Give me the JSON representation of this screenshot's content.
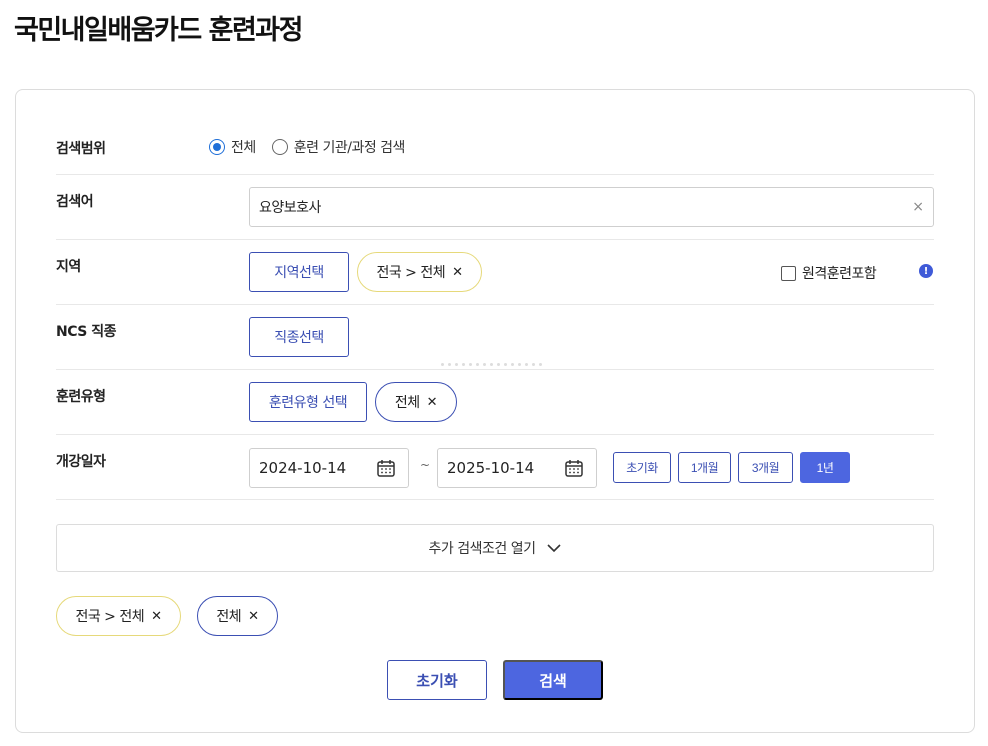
{
  "page": {
    "title": "국민내일배움카드 훈련과정"
  },
  "scope": {
    "label": "검색범위",
    "options": [
      {
        "label": "전체",
        "checked": true
      },
      {
        "label": "훈련 기관/과정 검색",
        "checked": false
      }
    ]
  },
  "keyword": {
    "label": "검색어",
    "value": "요양보호사",
    "clear_icon": "×"
  },
  "region": {
    "label": "지역",
    "select_button": "지역선택",
    "chip": "전국 > 전체",
    "remote_checkbox": "원격훈련포함",
    "remote_checked": false,
    "info_icon": "!"
  },
  "ncs": {
    "label": "NCS 직종",
    "select_button": "직종선택"
  },
  "training_type": {
    "label": "훈련유형",
    "select_button": "훈련유형 선택",
    "chip": "전체"
  },
  "start_date": {
    "label": "개강일자",
    "from": "2024-10-14",
    "separator": "~",
    "to": "2025-10-14",
    "quick": [
      "초기화",
      "1개월",
      "3개월",
      "1년"
    ],
    "active_quick": "1년"
  },
  "expand": {
    "label": "추가 검색조건 열기"
  },
  "selected_chips": [
    {
      "label": "전국 > 전체",
      "style": "yellow"
    },
    {
      "label": "전체",
      "style": "blue"
    }
  ],
  "chip_remove_icon": "✕",
  "actions": {
    "reset": "초기화",
    "search": "검색"
  },
  "colors": {
    "primary": "#4d66e0",
    "outline": "#3b4fb3",
    "radio": "#1f6fd8",
    "chip_yellow": "#e6d97a"
  }
}
